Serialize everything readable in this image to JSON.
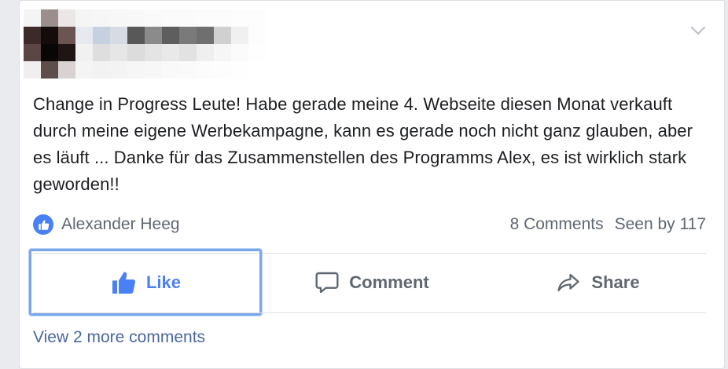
{
  "post": {
    "text": "Change in Progress Leute! Habe gerade meine 4. Webseite diesen Monat verkauft durch meine eigene Werbekampagne, kann es gerade noch nicht ganz glauben, aber es läuft ... Danke für das Zusammenstellen des Programms Alex, es ist wirklich stark geworden!!"
  },
  "reactions": {
    "reactor_name": "Alexander Heeg",
    "icon": "thumbs-up-icon"
  },
  "stats": {
    "comments": "8 Comments",
    "seen_by": "Seen by 117"
  },
  "actions": {
    "like_label": "Like",
    "comment_label": "Comment",
    "share_label": "Share"
  },
  "comments": {
    "more_link": "View 2 more comments"
  },
  "colors": {
    "accent": "#4a80f5",
    "link": "#4b67a1",
    "muted_text": "#606770",
    "focus_ring": "#7aa7ec"
  }
}
